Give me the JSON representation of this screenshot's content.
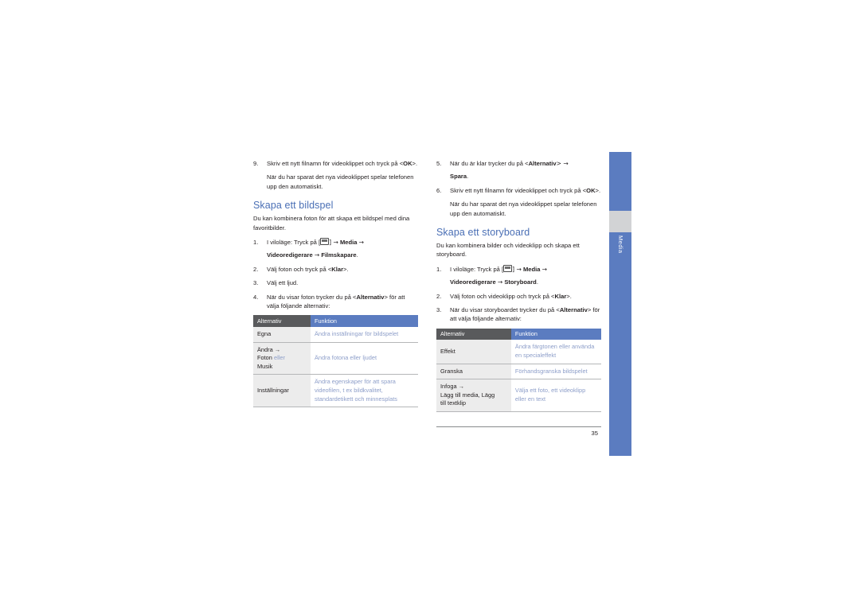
{
  "page": {
    "number": "35",
    "side_tab_label": "Media"
  },
  "left_column": {
    "continued_list": [
      {
        "num": "9.",
        "text_a": "Skriv ett nytt filnamn för videoklippet och tryck på <",
        "bold": "OK",
        "text_b": ">.",
        "note": "När du har sparat  det nya videoklippet spelar telefonen upp den automatiskt."
      }
    ],
    "section": {
      "title": "Skapa ett bildspel",
      "intro": "Du kan kombinera foton för att skapa ett bildspel med dina favoritbilder.",
      "steps": [
        {
          "num": "1.",
          "pre": "I viloläge: Tryck på [",
          "icon": "menu-key-icon",
          "post": "] →",
          "bold1": "Media",
          "arrow1": "→",
          "bold2": "Videoredigerare",
          "arrow2": "→",
          "bold3": "Filmskapare",
          "tail": "."
        },
        {
          "num": "2.",
          "pre": "Välj foton och tryck på <",
          "bold1": "Klar",
          "post": ">."
        },
        {
          "num": "3.",
          "pre": "Välj ett ljud."
        },
        {
          "num": "4.",
          "pre": "När du visar foton trycker du på <",
          "bold1": "Alternativ",
          "post": "> för att välja följande alternativ:"
        }
      ],
      "table": {
        "headers": [
          "Alternativ",
          "Funktion"
        ],
        "rows": [
          {
            "option": "Egna",
            "option_plain": "Egna",
            "function": "Ändra inställningar för bildspelet"
          },
          {
            "option_line1": "Ändra →",
            "option_line2_a": "Foton",
            "option_line2_b": "eller",
            "option_line3": "Musik",
            "function": "Ändra fotona eller ljudet"
          },
          {
            "option": "Inställningar",
            "function": "Ändra egenskaper för att spara videofilen, t ex bildkvalitet, standardetikett och minnesplats"
          }
        ]
      }
    }
  },
  "right_column": {
    "continued_list": [
      {
        "num": "5.",
        "text_a": "När du är klar trycker du på <",
        "bold": "Alternativ",
        "text_b": "> →",
        "bold2": "Spara",
        "tail": "."
      },
      {
        "num": "6.",
        "text_a": "Skriv ett nytt filnamn för videoklippet och tryck på <",
        "bold": "OK",
        "text_b": ">.",
        "note": "När du har sparat det nya videoklippet spelar telefonen upp den automatiskt."
      }
    ],
    "section": {
      "title": "Skapa ett storyboard",
      "intro": "Du kan kombinera bilder och videoklipp och skapa ett storyboard.",
      "steps": [
        {
          "num": "1.",
          "pre": "I viloläge: Tryck på [",
          "icon": "menu-key-icon",
          "post": "] →",
          "bold1": "Media",
          "arrow1": "→",
          "bold2": "Videoredigerare",
          "arrow2": "→",
          "bold3": "Storyboard",
          "tail": "."
        },
        {
          "num": "2.",
          "pre": "Välj foton och videoklipp och tryck på <",
          "bold1": "Klar",
          "post": ">."
        },
        {
          "num": "3.",
          "pre": "När du visar storyboardet trycker du på <",
          "bold1": "Alternativ",
          "post": "> för att välja följande alternativ:"
        }
      ],
      "table": {
        "headers": [
          "Alternativ",
          "Funktion"
        ],
        "rows": [
          {
            "option": "Effekt",
            "function": "Ändra färgtonen eller använda en specialeffekt"
          },
          {
            "option": "Granska",
            "function": "Förhandsgranska bildspelet"
          },
          {
            "option_line1": "Infoga →",
            "option_line2": "Lägg till media, Lägg",
            "option_line3": "till textklip",
            "function": "Välja ett foto, ett videoklipp eller en text"
          }
        ]
      }
    }
  },
  "colors": {
    "accent_blue": "#5b7cc0",
    "heading_blue": "#4a6fb5",
    "function_text": "#8d9ec9",
    "header_gray": "#595a5c",
    "cell_gray": "#ececec"
  }
}
